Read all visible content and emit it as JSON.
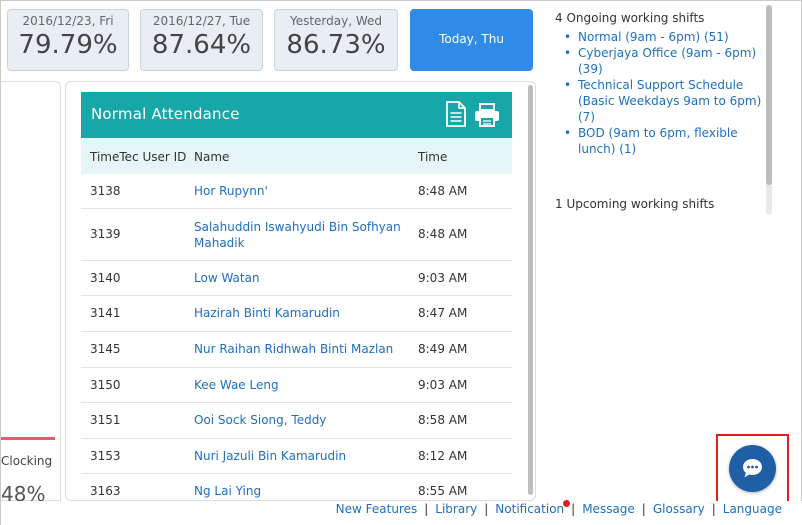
{
  "stats": [
    {
      "date": "2016/12/23, Fri",
      "pct": "79.79%"
    },
    {
      "date": "2016/12/27, Tue",
      "pct": "87.64%"
    },
    {
      "date": "Yesterday, Wed",
      "pct": "86.73%"
    },
    {
      "date": "Today, Thu"
    }
  ],
  "left": {
    "clocking": "Clocking",
    "pct": "48%"
  },
  "attendance": {
    "title": "Normal Attendance",
    "columns": {
      "id": "TimeTec User ID",
      "name": "Name",
      "time": "Time"
    },
    "rows": [
      {
        "id": "3138",
        "name": "Hor Rupynn'",
        "time": "8:48 AM"
      },
      {
        "id": "3139",
        "name": "Salahuddin Iswahyudi Bin Sofhyan Mahadik",
        "time": "8:48 AM"
      },
      {
        "id": "3140",
        "name": "Low Watan",
        "time": "9:03 AM"
      },
      {
        "id": "3141",
        "name": "Hazirah Binti Kamarudin",
        "time": "8:47 AM"
      },
      {
        "id": "3145",
        "name": "Nur Raihan Ridhwah Binti Mazlan",
        "time": "8:49 AM"
      },
      {
        "id": "3150",
        "name": "Kee Wae Leng",
        "time": "9:03 AM"
      },
      {
        "id": "3151",
        "name": "Ooi Sock Siong, Teddy",
        "time": "8:58 AM"
      },
      {
        "id": "3153",
        "name": "Nuri Jazuli Bin Kamarudin",
        "time": "8:12 AM"
      },
      {
        "id": "3163",
        "name": "Ng Lai Ying",
        "time": "8:55 AM"
      }
    ]
  },
  "shifts": {
    "ongoing_heading": "4 Ongoing working shifts",
    "ongoing": [
      "Normal (9am - 6pm) (51)",
      "Cyberjaya Office (9am - 6pm) (39)",
      "Technical Support Schedule (Basic Weekdays 9am to 6pm) (7)",
      "BOD (9am to 6pm, flexible lunch) (1)"
    ],
    "upcoming_heading": "1 Upcoming working shifts"
  },
  "footer": {
    "links": [
      "New Features",
      "Library",
      "Notification",
      "Message",
      "Glossary",
      "Language"
    ],
    "separator": "|"
  },
  "colors": {
    "accent": "#17a7a8",
    "active_card": "#2f8be6",
    "link": "#1f6fc0",
    "chat": "#1f5fa6",
    "highlight": "#e0201c"
  }
}
